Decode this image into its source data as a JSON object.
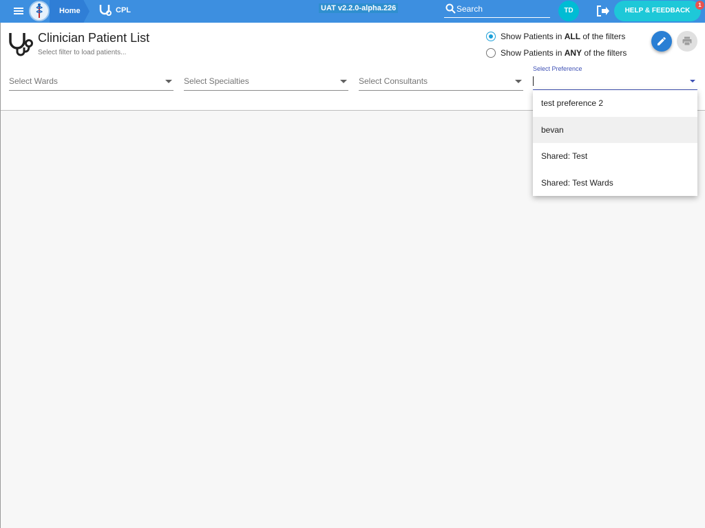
{
  "topbar": {
    "home_label": "Home",
    "cpl_label": "CPL",
    "version": "UAT v2.2.0-alpha.226",
    "search_placeholder": "Search",
    "avatar_initials": "TD",
    "help_label": "HELP & FEEDBACK",
    "help_badge": "1",
    "icons": [
      "menu-icon",
      "app-logo-icon",
      "stethoscope-icon",
      "search-icon",
      "logout-icon"
    ]
  },
  "header": {
    "title": "Clinician Patient List",
    "subtitle": "Select filter to load patients...",
    "filter_mode": {
      "all": {
        "prefix": "Show Patients in ",
        "emph": "ALL",
        "suffix": " of the filters",
        "selected": true
      },
      "any": {
        "prefix": "Show Patients in ",
        "emph": "ANY",
        "suffix": " of the filters",
        "selected": false
      }
    },
    "actions": [
      "edit-icon",
      "print-icon"
    ]
  },
  "filters": {
    "wards_placeholder": "Select Wards",
    "specialties_placeholder": "Select Specialties",
    "consultants_placeholder": "Select Consultants",
    "preference_label": "Select Preference",
    "preference_value": ""
  },
  "preference_options": [
    "test preference 2",
    "bevan",
    "Shared: Test",
    "Shared: Test Wards"
  ],
  "colors": {
    "topbar": "#3d8fe0",
    "accent": "#3f51b5",
    "help_button": "#1ec8d8",
    "avatar": "#00bcd4",
    "edit_fab": "#2a7fd4"
  }
}
